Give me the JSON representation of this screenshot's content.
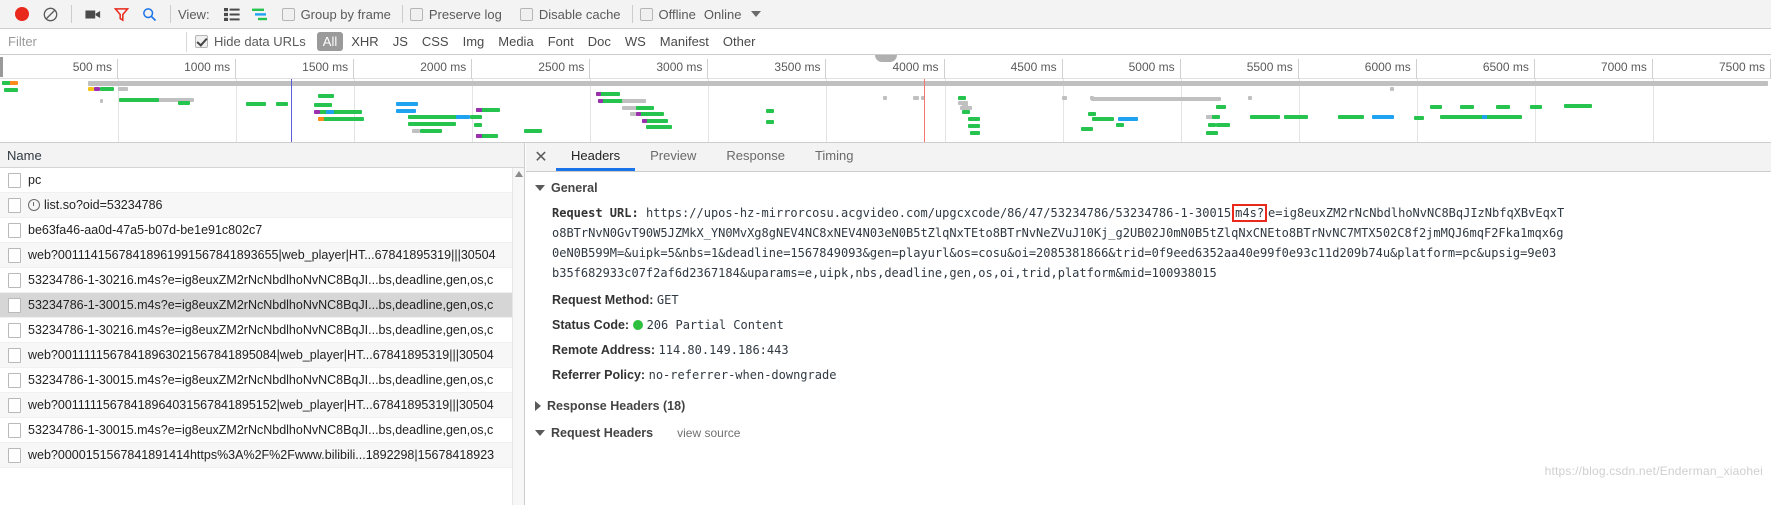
{
  "toolbar": {
    "record_icon": "record-icon",
    "clear_icon": "clear-icon",
    "camera_icon": "camera-icon",
    "filter_icon": "filter-funnel-icon",
    "search_icon": "search-icon",
    "view_label": "View:",
    "list_view_icon": "list-view-icon",
    "waterfall_view_icon": "waterfall-view-icon",
    "group_by_frame": "Group by frame",
    "preserve_log": "Preserve log",
    "disable_cache": "Disable cache",
    "offline": "Offline",
    "online": "Online",
    "throttle_caret": "chevron-down-icon"
  },
  "filterbar": {
    "placeholder": "Filter",
    "value": "",
    "hide_data_urls": "Hide data URLs",
    "hide_data_urls_checked": true,
    "types": [
      "All",
      "XHR",
      "JS",
      "CSS",
      "Img",
      "Media",
      "Font",
      "Doc",
      "WS",
      "Manifest",
      "Other"
    ],
    "selected_type": "All"
  },
  "overview": {
    "ticks": [
      "500 ms",
      "1000 ms",
      "1500 ms",
      "2000 ms",
      "2500 ms",
      "3000 ms",
      "3500 ms",
      "4000 ms",
      "4500 ms",
      "5000 ms",
      "5500 ms",
      "6000 ms",
      "6500 ms",
      "7000 ms",
      "7500 ms"
    ],
    "dom_content_loaded_ms": 1300,
    "load_event_ms": 4120,
    "colors": {
      "green": "#26c44e",
      "blue": "#1fa2f0",
      "yellow": "#f5c518",
      "purple": "#9b2fae",
      "gray": "#c0c0c0",
      "dcl_line": "#5b5fd6",
      "load_line": "#f5766e"
    }
  },
  "requests": {
    "column_header": "Name",
    "rows": [
      {
        "name": "pc",
        "icon": "document-icon",
        "selected": false
      },
      {
        "name": "list.so?oid=53234786",
        "icon": "pending-clock-icon",
        "selected": false
      },
      {
        "name": "be63fa46-aa0d-47a5-b07d-be1e91c802c7",
        "icon": "document-icon",
        "selected": false
      },
      {
        "name": "web?00111415678418961991567841893655|web_player|HT...67841895319|||30504",
        "icon": "document-icon",
        "selected": false
      },
      {
        "name": "53234786-1-30216.m4s?e=ig8euxZM2rNcNbdlhoNvNC8BqJI...bs,deadline,gen,os,c",
        "icon": "document-icon",
        "selected": false
      },
      {
        "name": "53234786-1-30015.m4s?e=ig8euxZM2rNcNbdlhoNvNC8BqJI...bs,deadline,gen,os,c",
        "icon": "document-icon",
        "selected": true
      },
      {
        "name": "53234786-1-30216.m4s?e=ig8euxZM2rNcNbdlhoNvNC8BqJI...bs,deadline,gen,os,c",
        "icon": "document-icon",
        "selected": false
      },
      {
        "name": "web?00111115678418963021567841895084|web_player|HT...67841895319|||30504",
        "icon": "document-icon",
        "selected": false
      },
      {
        "name": "53234786-1-30015.m4s?e=ig8euxZM2rNcNbdlhoNvNC8BqJI...bs,deadline,gen,os,c",
        "icon": "document-icon",
        "selected": false
      },
      {
        "name": "web?00111115678418964031567841895152|web_player|HT...67841895319|||30504",
        "icon": "document-icon",
        "selected": false
      },
      {
        "name": "53234786-1-30015.m4s?e=ig8euxZM2rNcNbdlhoNvNC8BqJI...bs,deadline,gen,os,c",
        "icon": "document-icon",
        "selected": false
      },
      {
        "name": "web?0000151567841891414https%3A%2F%2Fwww.bilibili...1892298|15678418923",
        "icon": "document-icon",
        "selected": false
      }
    ]
  },
  "detail": {
    "close_icon": "close-icon",
    "tabs": [
      "Headers",
      "Preview",
      "Response",
      "Timing"
    ],
    "active_tab": "Headers",
    "general": {
      "title": "General",
      "request_url_label": "Request URL:",
      "request_url_lines": [
        "https://upos-hz-mirrorcosu.acgvideo.com/upgcxcode/86/47/53234786/53234786-1-30015",
        "o8BTrNvN0GvT90W5JZMkX_YN0MvXg8gNEV4NC8xNEV4N03eN0B5tZlqNxTEto8BTrNvNeZVuJ10Kj_g2UB02J0mN0B5tZlqNxCNEto8BTrNvNC7MTX502C8f2jmMQJ6mqF2Fka1mqx6g",
        "0eN0B599M=&uipk=5&nbs=1&deadline=1567849093&gen=playurl&os=cosu&oi=2085381866&trid=0f9eed6352aa40e99f0e93c11d209b74u&platform=pc&upsig=9e03",
        "b35f682933c07f2af6d2367184&uparams=e,uipk,nbs,deadline,gen,os,oi,trid,platform&mid=100938015"
      ],
      "url_highlight": "m4s?",
      "url_line1_suffix": "e=ig8euxZM2rNcNbdlhoNvNC8BqJIzNbfqXBvEqxT",
      "request_method_label": "Request Method:",
      "request_method": "GET",
      "status_code_label": "Status Code:",
      "status_code": "206 Partial Content",
      "status_dot_color": "#2fbf3e",
      "remote_address_label": "Remote Address:",
      "remote_address": "114.80.149.186:443",
      "referrer_policy_label": "Referrer Policy:",
      "referrer_policy": "no-referrer-when-downgrade"
    },
    "response_headers": "Response Headers (18)",
    "request_headers": "Request Headers",
    "view_source": "view source"
  },
  "watermark": "https://blog.csdn.net/Enderman_xiaohei"
}
